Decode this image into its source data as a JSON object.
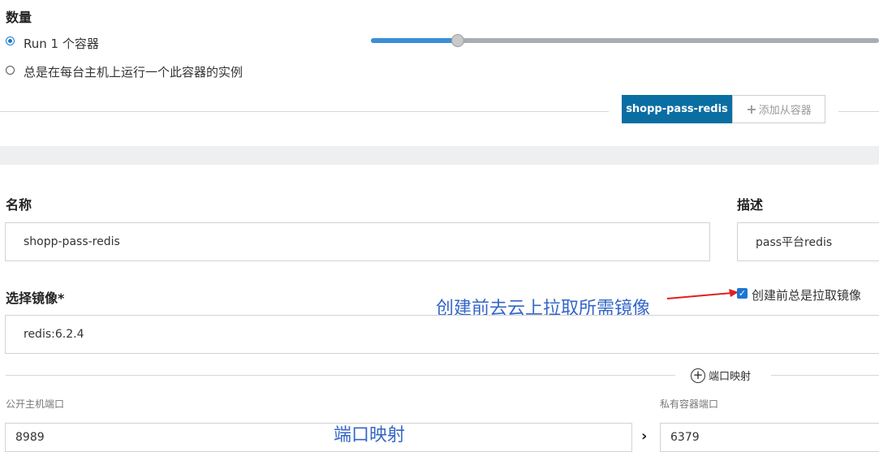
{
  "quantity": {
    "title": "数量",
    "option_run": "Run 1 个容器",
    "option_every_host": "总是在每台主机上运行一个此容器的实例",
    "slider_value": 1
  },
  "tabs": {
    "active": "shopp-pass-redis",
    "add_sidecar": "添加从容器"
  },
  "form": {
    "name_label": "名称",
    "name_value": "shopp-pass-redis",
    "desc_label": "描述",
    "desc_value": "pass平台redis",
    "image_label": "选择镜像*",
    "image_value": "redis:6.2.4",
    "pull_checkbox_label": "创建前总是拉取镜像",
    "pull_checkbox_checked": true,
    "port_mapping_button": "端口映射",
    "public_port_label": "公开主机端口",
    "public_port_value": "8989",
    "private_port_label": "私有容器端口",
    "private_port_value": "6379"
  },
  "annotations": {
    "pull_note": "创建前去云上拉取所需镜像",
    "port_note": "端口映射",
    "color": "#3466c8",
    "arrow_color": "#e02020"
  },
  "colors": {
    "accent": "#0b6ea3",
    "slider_fill": "#3a8fd6",
    "radio": "#1b77d2"
  },
  "icons": {
    "add_tab": "plus-icon",
    "port_mapping": "plus-circle-icon",
    "arrow": "chevron-right-icon",
    "checkbox": "checkmark-icon"
  }
}
